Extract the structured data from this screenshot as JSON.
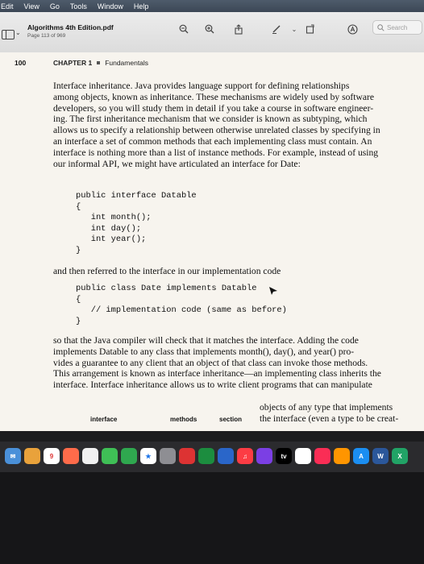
{
  "menubar": {
    "items": [
      "Edit",
      "View",
      "Go",
      "Tools",
      "Window",
      "Help"
    ]
  },
  "toolbar": {
    "title": "Algorithms 4th Edition.pdf",
    "page_info": "Page 113 of 969",
    "search_placeholder": "Search"
  },
  "page": {
    "page_number": "100",
    "chapter_label": "CHAPTER 1",
    "chapter_name": "Fundamentals",
    "para1_lines": [
      "Interface inheritance. Java provides language support for defining relationships",
      "among objects, known as inheritance. These mechanisms are widely used by software",
      "developers, so you will study them in detail if you take a course in software engineer-",
      "ing. The first inheritance mechanism that we consider is known as subtyping, which",
      "allows us to specify a relationship between otherwise unrelated classes by specifying in",
      "an interface a set of common methods that each implementing class must contain. An",
      "interface is nothing more than a list of instance methods. For example, instead of using",
      "our informal API, we might have articulated an interface for Date:"
    ],
    "code1": "public interface Datable\n{\n   int month();\n   int day();\n   int year();\n}",
    "para2": "and then referred to the interface in our implementation code",
    "code2": "public class Date implements Datable\n{\n   // implementation code (same as before)\n}",
    "para3_lines": [
      "so that the Java compiler will check that it matches the interface. Adding the code",
      "implements Datable to any class that implements month(), day(), and year() pro-",
      "vides a guarantee to any client that an object of that class can invoke those methods.",
      "This arrangement is known as interface inheritance—an implementing class inherits the",
      "interface. Interface inheritance allows us to write client programs that can manipulate"
    ],
    "para4_lines": [
      "objects of any type that implements",
      "the interface (even a type to be creat-"
    ],
    "margin_terms": [
      "interface",
      "methods",
      "section"
    ]
  },
  "dock": {
    "calendar_day": "9",
    "tv_label": "tv"
  }
}
